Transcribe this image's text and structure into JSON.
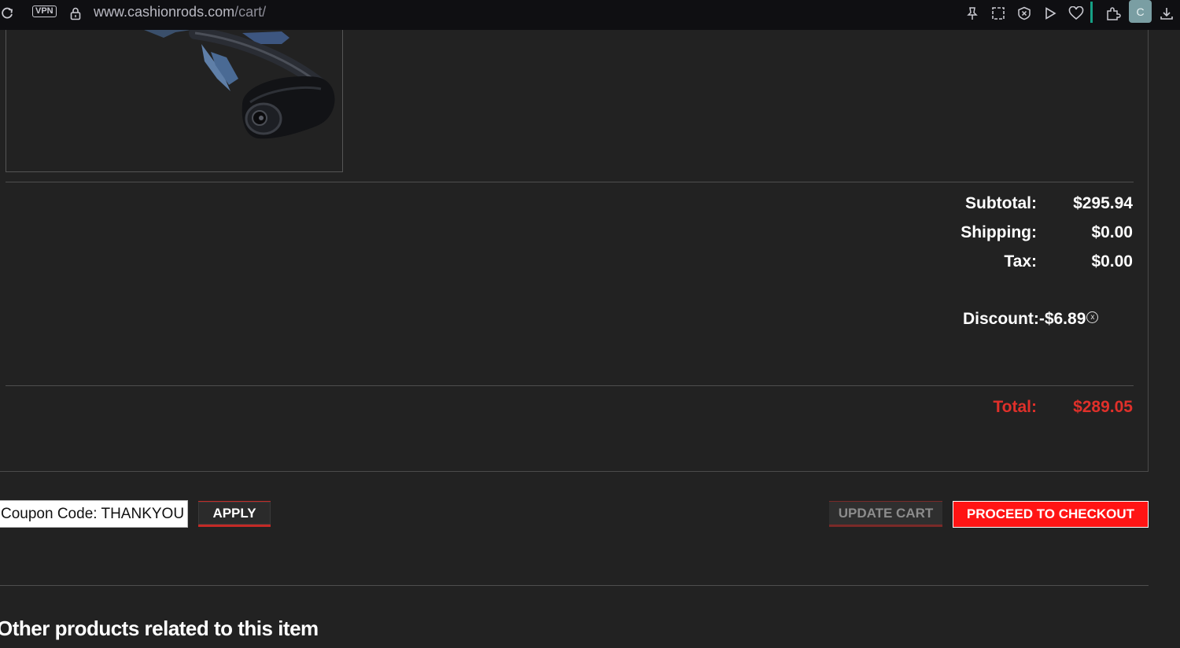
{
  "browser": {
    "url_domain": "www.cashionrods.com",
    "url_path": "/cart/",
    "vpn_label": "VPN",
    "profile_initial": "C",
    "accent_color": "#16a085"
  },
  "cart": {
    "subtotal_label": "Subtotal:",
    "subtotal_value": "$295.94",
    "shipping_label": "Shipping:",
    "shipping_value": "$0.00",
    "tax_label": "Tax:",
    "tax_value": "$0.00",
    "discount_label": "Discount:",
    "discount_value": "-$6.89",
    "discount_remove": "x",
    "total_label": "Total:",
    "total_value": "$289.05",
    "total_color": "#e0302a"
  },
  "actions": {
    "coupon_value": "Coupon Code: THANKYOU",
    "apply_label": "APPLY",
    "update_label": "UPDATE CART",
    "checkout_label": "PROCEED TO CHECKOUT",
    "checkout_color": "#ff1414"
  },
  "related": {
    "title": "Other products related to this item"
  },
  "icons": [
    "reload-icon",
    "lock-icon",
    "pin-icon",
    "screenshot-icon",
    "close-box-icon",
    "play-icon",
    "heart-icon",
    "extensions-icon",
    "download-icon"
  ]
}
